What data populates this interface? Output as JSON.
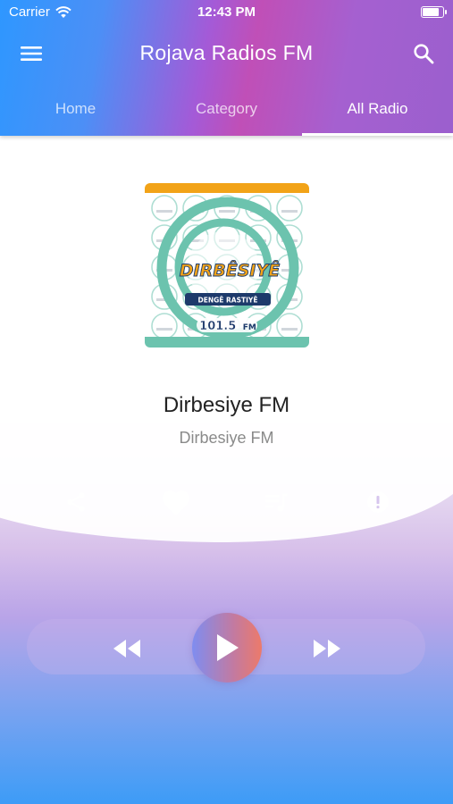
{
  "status_bar": {
    "carrier": "Carrier",
    "time": "12:43 PM",
    "battery_level": 0.92
  },
  "app_bar": {
    "title": "Rojava Radios FM",
    "menu_icon": "menu-icon",
    "search_icon": "search-icon"
  },
  "tabs": [
    {
      "label": "Home",
      "active": false
    },
    {
      "label": "Category",
      "active": false
    },
    {
      "label": "All Radio",
      "active": true
    }
  ],
  "now_playing": {
    "artwork": {
      "brand": "DIRBÊSIYÊ",
      "slogan": "DENGÊ RASTIYÊ",
      "frequency": "101.5",
      "unit": "FM",
      "colors": {
        "teal": "#6cc3ae",
        "orange": "#f2a318",
        "navy": "#1d3a6b"
      }
    },
    "title": "Dirbesiye FM",
    "subtitle": "Dirbesiye FM"
  },
  "actions": [
    {
      "icon": "share-icon"
    },
    {
      "icon": "heart-icon"
    },
    {
      "icon": "playlist-icon"
    },
    {
      "icon": "info-icon"
    }
  ],
  "player": {
    "previous_icon": "rewind-icon",
    "play_icon": "play-icon",
    "next_icon": "fast-forward-icon"
  },
  "colors": {
    "header_start": "#2e97ff",
    "header_mid": "#c04fb7",
    "header_end": "#9b5fce",
    "play_start": "#7f8df0",
    "play_end": "#ec7a6a"
  }
}
